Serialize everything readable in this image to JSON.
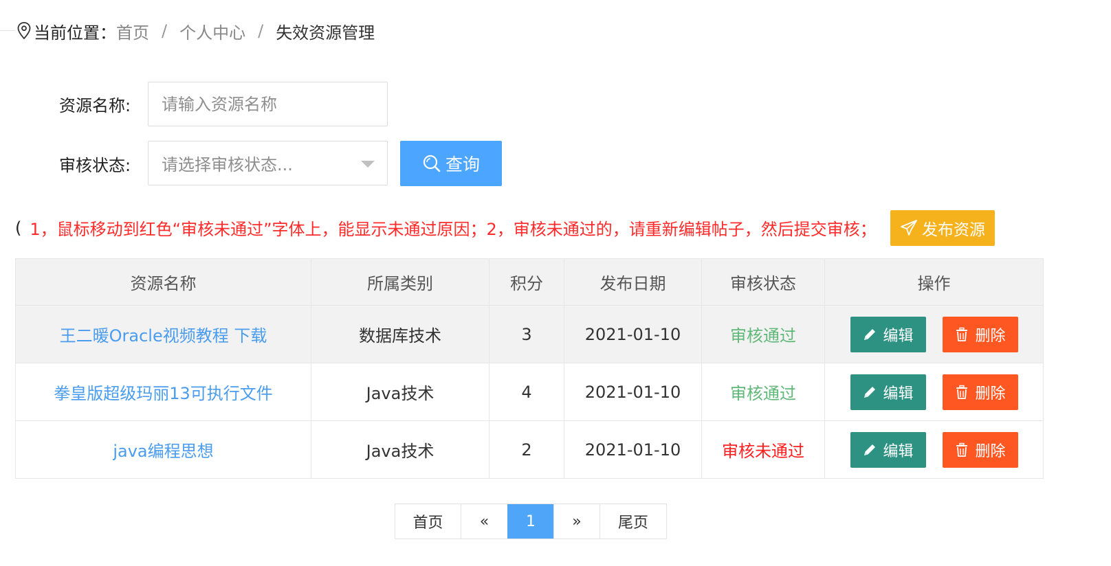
{
  "breadcrumb": {
    "prefix": "当前位置：",
    "items": [
      "首页",
      "个人中心",
      "失效资源管理"
    ],
    "separator": "/"
  },
  "search": {
    "name_label": "资源名称:",
    "name_placeholder": "请输入资源名称",
    "status_label": "审核状态:",
    "status_placeholder": "请选择审核状态...",
    "query_label": "查询"
  },
  "notice": {
    "open": "(",
    "text": "1，鼠标移动到红色“审核未通过”字体上，能显示未通过原因；2，审核未通过的，请重新编辑帖子，然后提交审核；",
    "close": ")",
    "publish_label": "发布资源"
  },
  "table": {
    "headers": [
      "资源名称",
      "所属类别",
      "积分",
      "发布日期",
      "审核状态",
      "操作"
    ],
    "rows": [
      {
        "name": "王二暖Oracle视频教程 下载",
        "category": "数据库技术",
        "points": "3",
        "date": "2021-01-10",
        "status": "审核通过",
        "status_type": "pass"
      },
      {
        "name": "拳皇版超级玛丽13可执行文件",
        "category": "Java技术",
        "points": "4",
        "date": "2021-01-10",
        "status": "审核通过",
        "status_type": "pass"
      },
      {
        "name": "java编程思想",
        "category": "Java技术",
        "points": "2",
        "date": "2021-01-10",
        "status": "审核未通过",
        "status_type": "fail"
      }
    ],
    "edit_label": "编辑",
    "delete_label": "删除"
  },
  "pagination": {
    "first": "首页",
    "prev": "«",
    "current": "1",
    "next": "»",
    "last": "尾页"
  },
  "colors": {
    "primary": "#4fa5f7",
    "edit": "#2e9283",
    "delete": "#ff5722",
    "publish": "#f5b21d",
    "pass": "#5fb878",
    "fail": "#ff1f1f",
    "link": "#4a9cee"
  }
}
